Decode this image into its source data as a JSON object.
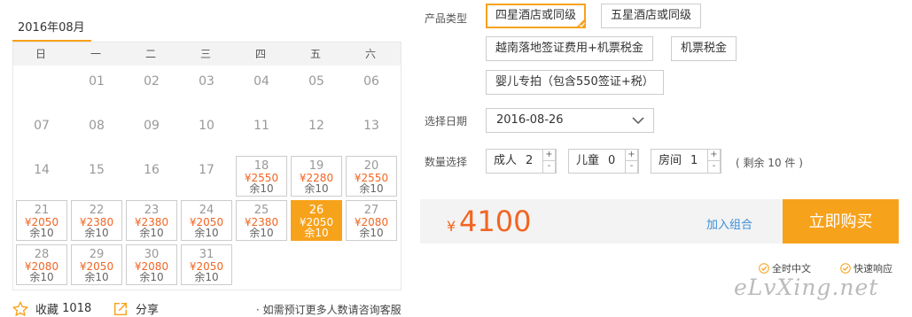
{
  "calendar": {
    "month": "2016年08月",
    "weekdays": [
      "日",
      "一",
      "二",
      "三",
      "四",
      "五",
      "六"
    ],
    "days": [
      {
        "d": "01",
        "col": 1,
        "row": 0
      },
      {
        "d": "02",
        "col": 2,
        "row": 0
      },
      {
        "d": "03",
        "col": 3,
        "row": 0
      },
      {
        "d": "04",
        "col": 4,
        "row": 0
      },
      {
        "d": "05",
        "col": 5,
        "row": 0
      },
      {
        "d": "06",
        "col": 6,
        "row": 0
      },
      {
        "d": "07",
        "col": 0,
        "row": 1
      },
      {
        "d": "08",
        "col": 1,
        "row": 1
      },
      {
        "d": "09",
        "col": 2,
        "row": 1
      },
      {
        "d": "10",
        "col": 3,
        "row": 1
      },
      {
        "d": "11",
        "col": 4,
        "row": 1
      },
      {
        "d": "12",
        "col": 5,
        "row": 1
      },
      {
        "d": "13",
        "col": 6,
        "row": 1
      },
      {
        "d": "14",
        "col": 0,
        "row": 2
      },
      {
        "d": "15",
        "col": 1,
        "row": 2
      },
      {
        "d": "16",
        "col": 2,
        "row": 2
      },
      {
        "d": "17",
        "col": 3,
        "row": 2
      },
      {
        "d": "18",
        "col": 4,
        "row": 2,
        "price": "¥2550",
        "remain": "余10"
      },
      {
        "d": "19",
        "col": 5,
        "row": 2,
        "price": "¥2280",
        "remain": "余10"
      },
      {
        "d": "20",
        "col": 6,
        "row": 2,
        "price": "¥2550",
        "remain": "余10"
      },
      {
        "d": "21",
        "col": 0,
        "row": 3,
        "price": "¥2050",
        "remain": "余10"
      },
      {
        "d": "22",
        "col": 1,
        "row": 3,
        "price": "¥2380",
        "remain": "余10"
      },
      {
        "d": "23",
        "col": 2,
        "row": 3,
        "price": "¥2380",
        "remain": "余10"
      },
      {
        "d": "24",
        "col": 3,
        "row": 3,
        "price": "¥2050",
        "remain": "余10"
      },
      {
        "d": "25",
        "col": 4,
        "row": 3,
        "price": "¥2380",
        "remain": "余10"
      },
      {
        "d": "26",
        "col": 5,
        "row": 3,
        "price": "¥2050",
        "remain": "余10",
        "selected": true
      },
      {
        "d": "27",
        "col": 6,
        "row": 3,
        "price": "¥2080",
        "remain": "余10"
      },
      {
        "d": "28",
        "col": 0,
        "row": 4,
        "price": "¥2080",
        "remain": "余10"
      },
      {
        "d": "29",
        "col": 1,
        "row": 4,
        "price": "¥2050",
        "remain": "余10"
      },
      {
        "d": "30",
        "col": 2,
        "row": 4,
        "price": "¥2080",
        "remain": "余10"
      },
      {
        "d": "31",
        "col": 3,
        "row": 4,
        "price": "¥2050",
        "remain": "余10"
      }
    ]
  },
  "bottom": {
    "fav_label": "收藏",
    "fav_count": "1018",
    "share_label": "分享",
    "note": "· 如需预订更多人数请咨询客服"
  },
  "product": {
    "type_label": "产品类型",
    "options": [
      "四星酒店或同级",
      "五星酒店或同级",
      "越南落地签证费用+机票税金",
      "机票税金",
      "婴儿专拍（包含550签证+税）"
    ],
    "selected_index": 0
  },
  "date": {
    "label": "选择日期",
    "value": "2016-08-26"
  },
  "quantity": {
    "label": "数量选择",
    "adult_label": "成人",
    "adult_value": "2",
    "child_label": "儿童",
    "child_value": "0",
    "room_label": "房间",
    "room_value": "1",
    "plus": "+",
    "minus": "-",
    "remain": "( 剩余 10 件 )"
  },
  "price": {
    "currency": "¥",
    "total": "4100",
    "add_combo": "加入组合",
    "buy": "立即购买"
  },
  "services": [
    "全时中文",
    "快速响应"
  ],
  "watermark": "eLvXing.net",
  "colors": {
    "accent": "#f7a21b",
    "price": "#f26522",
    "link": "#3b8fd6"
  }
}
